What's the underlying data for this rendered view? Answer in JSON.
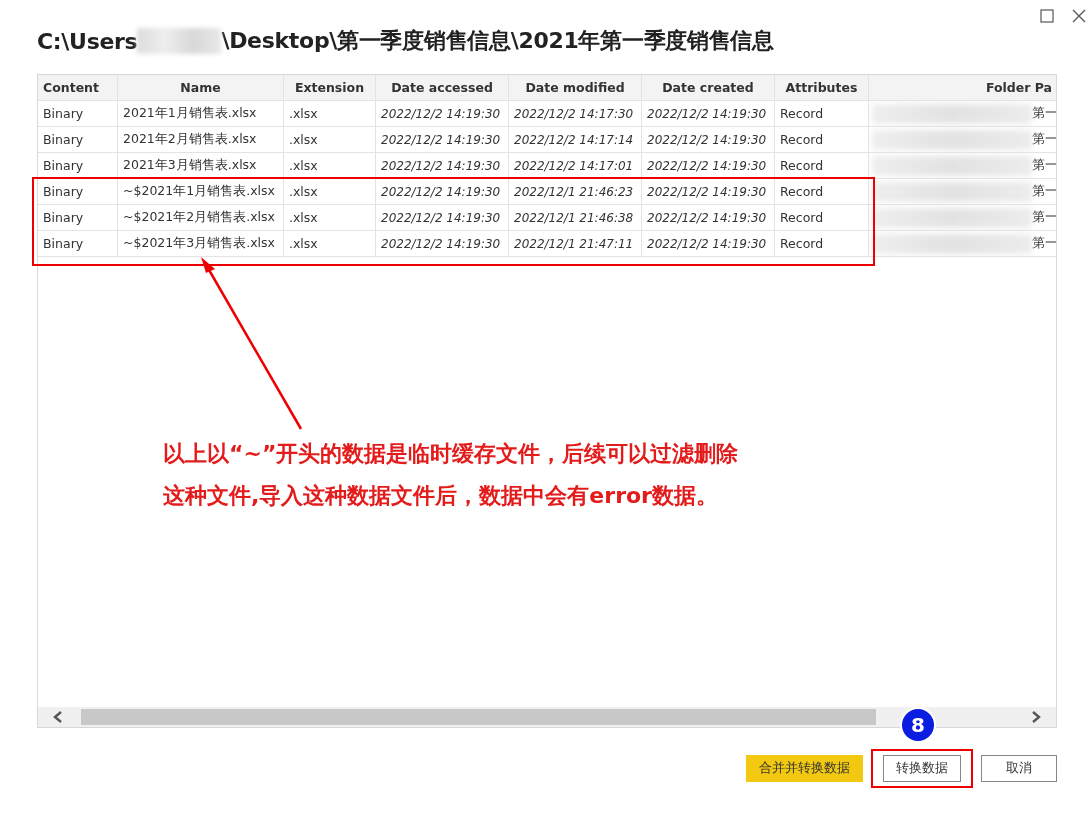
{
  "window": {
    "title_start": "C:\\Users",
    "title_end": "\\Desktop\\第一季度销售信息\\2021年第一季度销售信息"
  },
  "table": {
    "columns": [
      {
        "label": "Content",
        "kind": "text"
      },
      {
        "label": "Name",
        "kind": "text"
      },
      {
        "label": "Extension",
        "kind": "text"
      },
      {
        "label": "Date accessed",
        "kind": "date"
      },
      {
        "label": "Date modified",
        "kind": "date"
      },
      {
        "label": "Date created",
        "kind": "date"
      },
      {
        "label": "Attributes",
        "kind": "text"
      },
      {
        "label": "Folder Pa",
        "kind": "path"
      }
    ],
    "rows": [
      {
        "highlighted": false,
        "cells": [
          "Binary",
          "2021年1月销售表.xlsx",
          ".xlsx",
          "2022/12/2 14:19:30",
          "2022/12/2 14:17:30",
          "2022/12/2 14:19:30",
          "Record",
          "第一"
        ]
      },
      {
        "highlighted": false,
        "cells": [
          "Binary",
          "2021年2月销售表.xlsx",
          ".xlsx",
          "2022/12/2 14:19:30",
          "2022/12/2 14:17:14",
          "2022/12/2 14:19:30",
          "Record",
          "第一"
        ]
      },
      {
        "highlighted": false,
        "cells": [
          "Binary",
          "2021年3月销售表.xlsx",
          ".xlsx",
          "2022/12/2 14:19:30",
          "2022/12/2 14:17:01",
          "2022/12/2 14:19:30",
          "Record",
          "第一"
        ]
      },
      {
        "highlighted": true,
        "cells": [
          "Binary",
          "~$2021年1月销售表.xlsx",
          ".xlsx",
          "2022/12/2 14:19:30",
          "2022/12/1 21:46:23",
          "2022/12/2 14:19:30",
          "Record",
          "第一"
        ]
      },
      {
        "highlighted": true,
        "cells": [
          "Binary",
          "~$2021年2月销售表.xlsx",
          ".xlsx",
          "2022/12/2 14:19:30",
          "2022/12/1 21:46:38",
          "2022/12/2 14:19:30",
          "Record",
          "第一"
        ]
      },
      {
        "highlighted": true,
        "cells": [
          "Binary",
          "~$2021年3月销售表.xlsx",
          ".xlsx",
          "2022/12/2 14:19:30",
          "2022/12/1 21:47:11",
          "2022/12/2 14:19:30",
          "Record",
          "第一"
        ]
      }
    ]
  },
  "annotation": {
    "lines": [
      "以上以“~”开头的数据是临时缓存文件，后续可以过滤删除",
      "这种文件,导入这种数据文件后，数据中会有error数据。"
    ],
    "badge": "8"
  },
  "buttons": [
    {
      "label": "合并并转换数据",
      "kind": "primary",
      "annotated": false
    },
    {
      "label": "转换数据",
      "kind": "default",
      "annotated": true
    },
    {
      "label": "取消",
      "kind": "default",
      "annotated": false
    }
  ]
}
